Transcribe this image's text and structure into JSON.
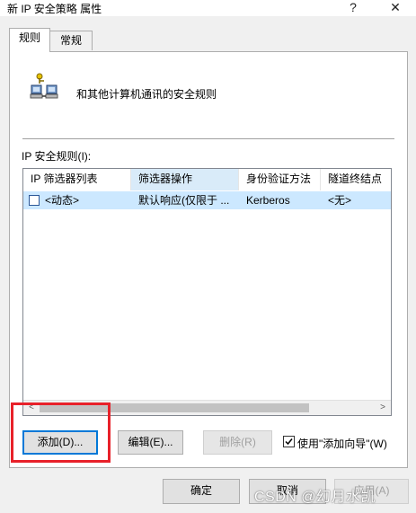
{
  "window": {
    "title": "新 IP 安全策略 属性",
    "help_label": "?",
    "close_label": "✕"
  },
  "tabs": [
    {
      "label": "规则"
    },
    {
      "label": "常规"
    }
  ],
  "rules_tab": {
    "description": "和其他计算机通讯的安全规则",
    "list_label": "IP 安全规则(I):",
    "columns": [
      "IP 筛选器列表",
      "筛选器操作",
      "身份验证方法",
      "隧道终结点"
    ],
    "rows": [
      {
        "checked": false,
        "filter_list": "<动态>",
        "filter_action": "默认响应(仅限于 ...",
        "auth": "Kerberos",
        "tunnel": "<无>"
      }
    ],
    "scroll_left": "<",
    "scroll_right": ">",
    "add_label": "添加(D)...",
    "edit_label": "编辑(E)...",
    "remove_label": "删除(R)",
    "wizard_label": "使用\"添加向导\"(W)",
    "wizard_checked": true
  },
  "footer": {
    "ok_label": "确定",
    "cancel_label": "取消",
    "apply_label": "应用(A)"
  },
  "watermark": "CSDN @幻月水凯"
}
